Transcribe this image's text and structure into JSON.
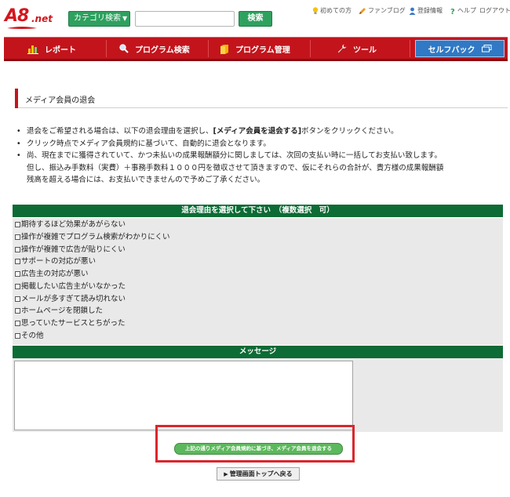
{
  "brand": {
    "logo_main": "A8",
    "logo_sub": ".net"
  },
  "header": {
    "category_button": "カテゴリ検索",
    "search_placeholder": "",
    "search_button": "検索",
    "links": [
      {
        "label": "初めての方",
        "icon": "lightbulb-icon"
      },
      {
        "label": "ファンブログ",
        "icon": "pencil-icon"
      },
      {
        "label": "登録情報",
        "icon": "user-icon"
      },
      {
        "label": "ヘルプ",
        "icon": "question-icon"
      },
      {
        "label": "ログアウト",
        "icon": ""
      }
    ]
  },
  "nav": {
    "items": [
      {
        "label": "レポート",
        "icon": "bar-chart-icon"
      },
      {
        "label": "プログラム検索",
        "icon": "magnifier-icon"
      },
      {
        "label": "プログラム管理",
        "icon": "folder-icon"
      },
      {
        "label": "ツール",
        "icon": "wrench-icon"
      }
    ],
    "selfback": "セルフバック"
  },
  "page": {
    "title": "メディア会員の退会",
    "notes": {
      "n1_a": "退会をご希望される場合は、以下の退会理由を選択し、",
      "n1_b": "[メディア会員を退会する]",
      "n1_c": "ボタンをクリックください。",
      "n2": "クリック時点でメディア会員規約に基づいて、自動的に退会となります。",
      "n3_1": "尚、現在までに獲得されていて、かつ未払いの成果報酬額分に関しましては、次回の支払い時に一括してお支払い致します。",
      "n3_2": "但し、振込み手数料（実費）＋事務手数料１０００円を徴収させて頂きますので、仮にそれらの合計が、貴方様の成果報酬額",
      "n3_3": "残高を超える場合には、お支払いできませんので予めご了承ください。"
    }
  },
  "reasons": {
    "header": "退会理由を選択して下さい　（複数選択　可）",
    "items": [
      "期待するほど効果があがらない",
      "操作が複雑でプログラム検索がわかりにくい",
      "操作が複雑で広告が貼りにくい",
      "サポートの対応が悪い",
      "広告主の対応が悪い",
      "掲載したい広告主がいなかった",
      "メールが多すぎて読み切れない",
      "ホームページを閉鎖した",
      "思っていたサービスとちがった",
      "その他"
    ]
  },
  "message": {
    "header": "メッセージ",
    "value": ""
  },
  "actions": {
    "submit": "上記の通りメディア会員規約に基づき、メディア会員を退会する",
    "back": "管理画面トップへ戻る"
  },
  "colors": {
    "brand_red": "#c3141c",
    "section_green": "#0d6b35",
    "button_green": "#2ea15f",
    "selfback_blue": "#3179c4",
    "highlight_red": "#d9262c"
  }
}
